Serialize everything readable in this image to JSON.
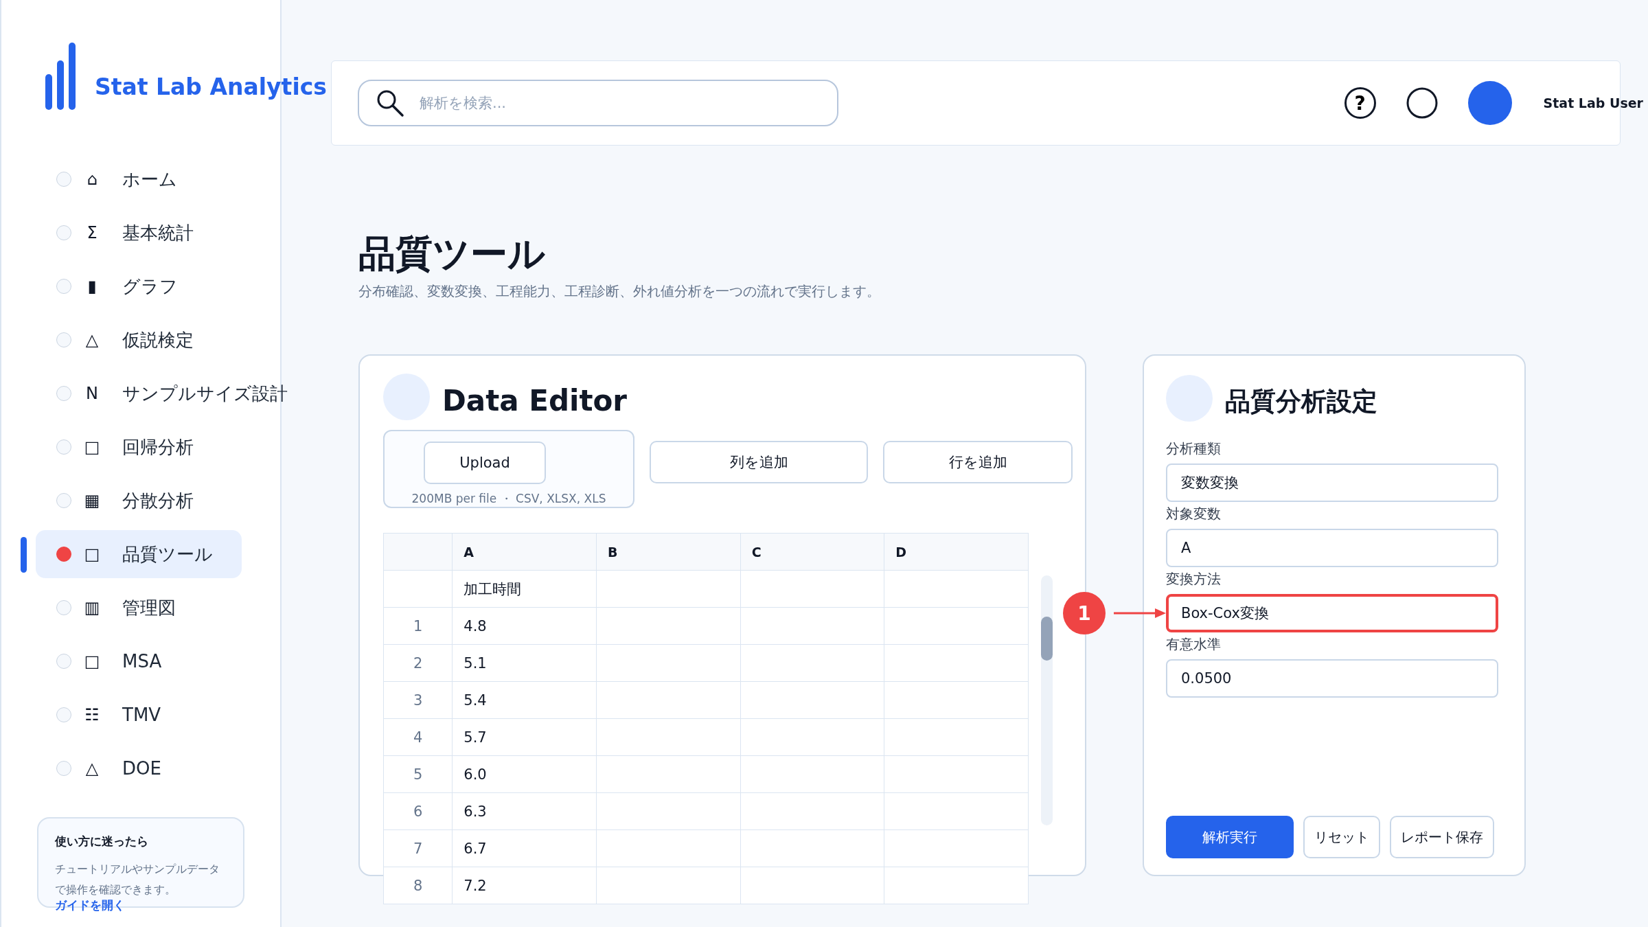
{
  "brand": {
    "name": "Stat Lab Analytics"
  },
  "sidebar": {
    "items": [
      {
        "icon": "⌂",
        "label": "ホーム",
        "selected": false
      },
      {
        "icon": "Σ",
        "label": "基本統計",
        "selected": false
      },
      {
        "icon": "▮",
        "label": "グラフ",
        "selected": false
      },
      {
        "icon": "△",
        "label": "仮説検定",
        "selected": false
      },
      {
        "icon": "N",
        "label": "サンプルサイズ設計",
        "selected": false
      },
      {
        "icon": "□",
        "label": "回帰分析",
        "selected": false
      },
      {
        "icon": "▦",
        "label": "分散分析",
        "selected": false
      },
      {
        "icon": "□",
        "label": "品質ツール",
        "selected": true
      },
      {
        "icon": "▥",
        "label": "管理図",
        "selected": false
      },
      {
        "icon": "□",
        "label": "MSA",
        "selected": false
      },
      {
        "icon": "☷",
        "label": "TMV",
        "selected": false
      },
      {
        "icon": "△",
        "label": "DOE",
        "selected": false
      }
    ],
    "help_card": {
      "title": "使い方に迷ったら",
      "text": "チュートリアルやサンプルデータで操作を確認できます。",
      "link": "ガイドを開く"
    }
  },
  "header": {
    "search": {
      "placeholder": "解析を検索..."
    },
    "help_label": "?",
    "user_name": "Stat Lab User"
  },
  "page": {
    "title": "品質ツール",
    "subtitle": "分布確認、変数変換、工程能力、工程診断、外れ値分析を一つの流れで実行します。"
  },
  "data_editor": {
    "title": "Data Editor",
    "upload": {
      "button": "Upload",
      "caption": "200MB per file ・ CSV, XLSX, XLS"
    },
    "buttons": [
      "列を追加",
      "行を追加"
    ],
    "table": {
      "columns": [
        "A",
        "B",
        "C",
        "D"
      ],
      "rows": [
        {
          "cells": [
            "加工時間"
          ]
        },
        {
          "num": "1",
          "cells": [
            "4.8"
          ]
        },
        {
          "num": "2",
          "cells": [
            "5.1"
          ]
        },
        {
          "num": "3",
          "cells": [
            "5.4"
          ]
        },
        {
          "num": "4",
          "cells": [
            "5.7"
          ]
        },
        {
          "num": "5",
          "cells": [
            "6.0"
          ]
        },
        {
          "num": "6",
          "cells": [
            "6.3"
          ]
        },
        {
          "num": "7",
          "cells": [
            "6.7"
          ]
        },
        {
          "num": "8",
          "cells": [
            "7.2"
          ]
        }
      ]
    }
  },
  "settings": {
    "title": "品質分析設定",
    "fields": [
      {
        "label": "分析種類",
        "value": "変数変換",
        "highlighted": false
      },
      {
        "label": "対象変数",
        "value": "A",
        "highlighted": false
      },
      {
        "label": "変換方法",
        "value": "Box-Cox変換",
        "highlighted": true,
        "annotation": "1"
      },
      {
        "label": "有意水準",
        "value": "0.0500",
        "highlighted": false
      }
    ],
    "buttons": [
      {
        "label": "解析実行",
        "kind": "primary"
      },
      {
        "label": "リセット",
        "kind": "secondary"
      },
      {
        "label": "レポート保存",
        "kind": "secondary"
      }
    ]
  }
}
